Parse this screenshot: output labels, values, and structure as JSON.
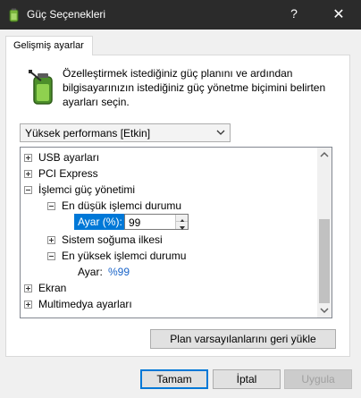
{
  "window": {
    "title": "Güç Seçenekleri",
    "help": "?",
    "close": "✕"
  },
  "tabs": [
    {
      "label": "Gelişmiş ayarlar"
    }
  ],
  "description": "Özelleştirmek istediğiniz güç planını ve ardından bilgisayarınızın istediğiniz güç yönetme biçimini belirten ayarları seçin.",
  "plan_select": {
    "selected": "Yüksek performans [Etkin]"
  },
  "tree": {
    "usb": "USB ayarları",
    "pci": "PCI Express",
    "cpu": "İşlemci güç yönetimi",
    "min_state": "En düşük işlemci durumu",
    "setting_label": "Ayar (%):",
    "setting_value": "99",
    "cooling": "Sistem soğuma ilkesi",
    "max_state": "En yüksek işlemci durumu",
    "max_label": "Ayar:",
    "max_value": "%99",
    "display": "Ekran",
    "multimedia": "Multimedya ayarları"
  },
  "buttons": {
    "restore": "Plan varsayılanlarını geri yükle",
    "ok": "Tamam",
    "cancel": "İptal",
    "apply": "Uygula"
  },
  "colors": {
    "titlebar": "#2b2b2b",
    "selection": "#0078d7",
    "link_value": "#1a64c8"
  }
}
